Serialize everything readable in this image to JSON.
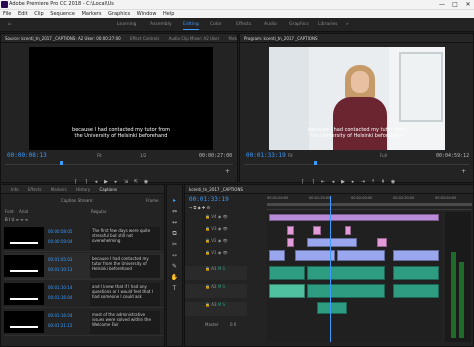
{
  "window": {
    "title": "Adobe Premiere Pro CC 2018 - C:\\Local\\Us",
    "controls": [
      "—",
      "□",
      "✕"
    ]
  },
  "menu": [
    "File",
    "Edit",
    "Clip",
    "Sequence",
    "Markers",
    "Graphics",
    "Window",
    "Help"
  ],
  "workspaces": {
    "items": [
      "Learning",
      "Assembly",
      "Editing",
      "Color",
      "Effects",
      "Audio",
      "Graphics",
      "Libraries"
    ],
    "active": "Editing",
    "more": "»"
  },
  "source_monitor": {
    "tabs": [
      "Source: kcenti_tn_2017 _CAPTIONS: A2 Uker: 00:00:27:00",
      "Effect Controls",
      "Audio Clip Mixer: A2 Uker",
      "Metadat"
    ],
    "caption_line1": "because I had contacted my tutor from",
    "caption_line2": "the University of Helsinki beforehand",
    "timecode_left": "00:00:08:13",
    "zoom": "Fit",
    "fraction": "1/2",
    "timecode_right": "00:00:27:00"
  },
  "program_monitor": {
    "tabs": [
      "Program: kcenti_tn_2017 _CAPTIONS"
    ],
    "caption_line1": "because I had contacted my tutor from",
    "caption_line2": "the University of Helsinki beforehand",
    "timecode_left": "00:01:33:19",
    "zoom": "Fit",
    "fraction": "Full",
    "timecode_right": "00:04:59:12"
  },
  "bottom_left_panel": {
    "tabs": [
      "Info",
      "Effects",
      "Markers",
      "History",
      "Captions"
    ],
    "row_a": "Caption Stream: ",
    "row_a_right": "Frame ",
    "font_label": "Font",
    "font_value": "Arial",
    "style_value": "Regular",
    "captions": [
      {
        "in": "00:00:58:05",
        "out": "00:00:59:04",
        "text": "The first few days were quite stressful but still not overwhelming"
      },
      {
        "in": "00:01:05:03",
        "out": "00:01:10:13",
        "text": "because I had contacted my tutor from the University of Helsinki beforehand"
      },
      {
        "in": "00:01:10:14",
        "out": "00:01:16:04",
        "text": "and I knew that if I had any questions or I would feel that I had someone I could ask"
      },
      {
        "in": "00:01:16:04",
        "out": "00:01:21:15",
        "text": "most of the administrative issues were solved within the Welcome Fair"
      }
    ]
  },
  "timeline": {
    "tab": "kcenti_tn_2017 _CAPTIONS",
    "timecode": "00:01:33:19",
    "ruler": [
      "00:01:00:00",
      "00:01:30:00",
      "00:02:00:00",
      "00:02:30:00",
      "00:03:00:00"
    ],
    "tracks_video": [
      "V4",
      "V3",
      "V2",
      "V1"
    ],
    "tracks_audio": [
      "A1",
      "A2",
      "A3"
    ],
    "master_label": "Master",
    "master_value": "0.0"
  },
  "tools": [
    "▸",
    "⇔",
    "↔",
    "⧉",
    "✂",
    "⇿",
    "✎",
    "✋",
    "T"
  ],
  "colors": {
    "accent": "#3a9cff",
    "video_clip": "#9aa7ee",
    "caption_clip": "#e39bd9",
    "audio_clip": "#2d9c81",
    "audio_clip_light": "#4fc0a0"
  }
}
